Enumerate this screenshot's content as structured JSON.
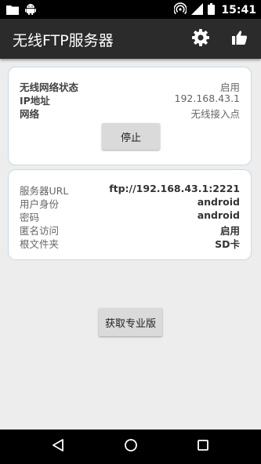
{
  "status_bar": {
    "time": "15:41"
  },
  "app_bar": {
    "title": "无线FTP服务器"
  },
  "wifi_card": {
    "rows": [
      {
        "label": "无线网络状态",
        "value": "启用"
      },
      {
        "label": "IP地址",
        "value": "192.168.43.1"
      },
      {
        "label": "网络",
        "value": "无线接入点"
      }
    ],
    "stop_button": "停止"
  },
  "server_card": {
    "rows": [
      {
        "label": "服务器URL",
        "value": "ftp://192.168.43.1:2221"
      },
      {
        "label": "用户身份",
        "value": "android"
      },
      {
        "label": "密码",
        "value": "android"
      },
      {
        "label": "匿名访问",
        "value": "启用"
      },
      {
        "label": "根文件夹",
        "value": "SD卡"
      }
    ]
  },
  "pro_button": "获取专业版",
  "icons": {
    "status_left": [
      "folder-icon",
      "android-icon"
    ],
    "status_right": [
      "hotspot-icon",
      "signal-icon",
      "battery-icon"
    ],
    "app_actions": [
      "gear-icon",
      "thumbs-up-icon"
    ],
    "navigation": [
      "back-icon",
      "home-icon",
      "recents-icon"
    ]
  }
}
